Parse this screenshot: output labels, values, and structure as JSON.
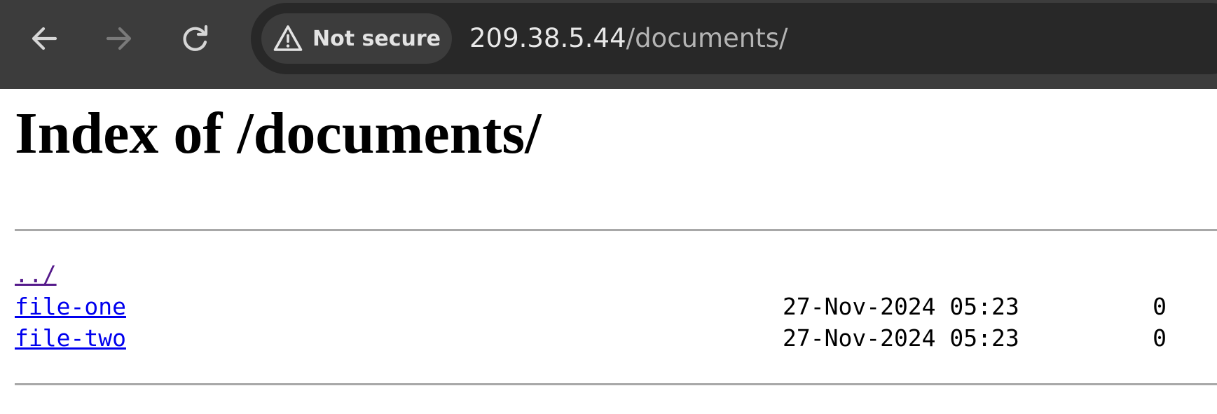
{
  "browser": {
    "nav": {
      "back_icon": "arrow-left-icon",
      "forward_icon": "arrow-right-icon",
      "reload_icon": "reload-icon"
    },
    "security": {
      "icon": "warning-triangle-icon",
      "label": "Not secure"
    },
    "url": {
      "host": "209.38.5.44",
      "path": "/documents/"
    }
  },
  "page": {
    "title": "Index of /documents/",
    "parent_link": "../",
    "entries": [
      {
        "name": "file-one",
        "modified": "27-Nov-2024 05:23",
        "size": "0"
      },
      {
        "name": "file-two",
        "modified": "27-Nov-2024 05:23",
        "size": "0"
      }
    ]
  },
  "colors": {
    "toolbar_bg": "#3c3c3c",
    "omnibox_bg": "#282828",
    "link_visited": "#551a8b",
    "link_unvisited": "#0000ee"
  }
}
